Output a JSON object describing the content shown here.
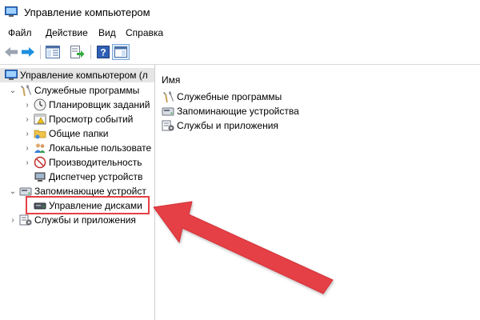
{
  "window": {
    "title": "Управление компьютером"
  },
  "menu": [
    {
      "label": "Файл"
    },
    {
      "label": "Действие"
    },
    {
      "label": "Вид"
    },
    {
      "label": "Справка"
    }
  ],
  "tree": {
    "root": "Управление компьютером (л",
    "system_tools": "Служебные программы",
    "scheduler": "Планировщик заданий",
    "event_viewer": "Просмотр событий",
    "shared_folders": "Общие папки",
    "local_users": "Локальные пользовате",
    "performance": "Производительность",
    "device_manager": "Диспетчер устройств",
    "storage": "Запоминающие устройст",
    "disk_management": "Управление дисками",
    "services": "Службы и приложения"
  },
  "content": {
    "column_header": "Имя",
    "items": [
      {
        "label": "Служебные программы",
        "icon": "tools-icon"
      },
      {
        "label": "Запоминающие устройства",
        "icon": "storage-icon"
      },
      {
        "label": "Службы и приложения",
        "icon": "services-icon"
      }
    ]
  },
  "annotation": {
    "highlight_color": "#e64046"
  }
}
